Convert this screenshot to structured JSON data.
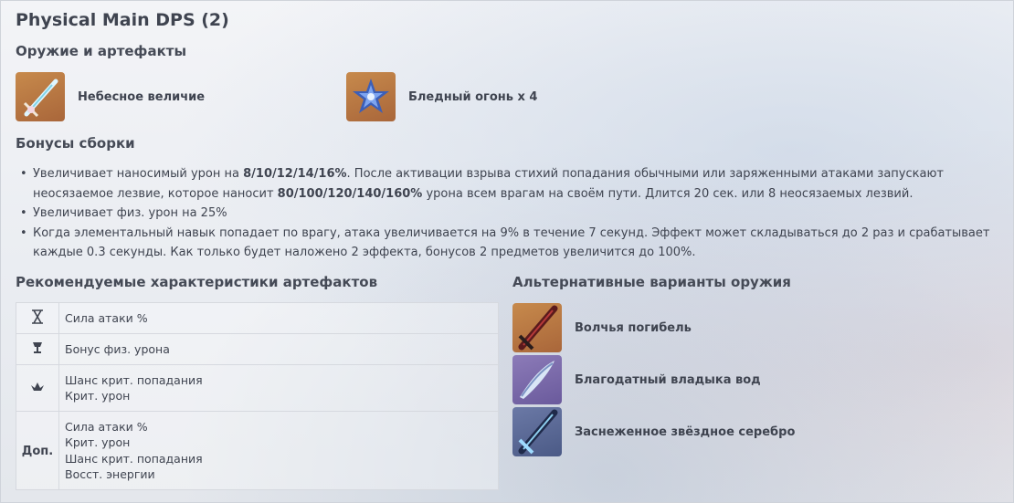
{
  "title": "Physical Main DPS (2)",
  "weapons_heading": "Оружие и артефакты",
  "weapon": {
    "name": "Небесное величие",
    "icon": "sword-icon"
  },
  "artifact": {
    "name": "Бледный огонь x 4",
    "icon": "flower-artifact-icon"
  },
  "bonuses_heading": "Бонусы сборки",
  "bonuses": [
    {
      "parts": [
        {
          "t": "Увеличивает наносимый урон на ",
          "b": false
        },
        {
          "t": "8/10/12/14/16%",
          "b": true
        },
        {
          "t": ". После активации взрыва стихий попадания обычными или заряженными атаками запускают неосязаемое лезвие, которое наносит ",
          "b": false
        },
        {
          "t": "80/100/120/140/160%",
          "b": true
        },
        {
          "t": " урона всем врагам на своём пути. Длится 20 сек. или 8 неосязаемых лезвий.",
          "b": false
        }
      ]
    },
    {
      "parts": [
        {
          "t": "Увеличивает физ. урон на 25%",
          "b": false
        }
      ]
    },
    {
      "parts": [
        {
          "t": "Когда элементальный навык попадает по врагу, атака увеличивается на 9% в течение 7 секунд. Эффект может складываться до 2 раз и срабатывает каждые 0.3 секунды. Как только будет наложено 2 эффекта, бонусов 2 предметов увеличится до 100%.",
          "b": false
        }
      ]
    }
  ],
  "stats_heading": "Рекомендуемые характеристики артефактов",
  "stats": [
    {
      "icon": "hourglass-icon",
      "label": "",
      "lines": [
        "Сила атаки %"
      ]
    },
    {
      "icon": "goblet-icon",
      "label": "",
      "lines": [
        "Бонус физ. урона"
      ]
    },
    {
      "icon": "circlet-icon",
      "label": "",
      "lines": [
        "Шанс крит. попадания",
        "Крит. урон"
      ]
    },
    {
      "icon": "",
      "label": "Доп.",
      "lines": [
        "Сила атаки %",
        "Крит. урон",
        "Шанс крит. попадания",
        "Восст. энергии"
      ]
    }
  ],
  "alt_heading": "Альтернативные варианты оружия",
  "alternatives": [
    {
      "name": "Волчья погибель",
      "icon": "greatsword-icon"
    },
    {
      "name": "Благодатный владыка вод",
      "icon": "fish-blade-icon"
    },
    {
      "name": "Заснеженное звёздное серебро",
      "icon": "snow-greatsword-icon"
    }
  ],
  "colors": {
    "text": "#3f4450",
    "gold_frame": "#b87645",
    "purple_frame": "#7a69aa"
  }
}
